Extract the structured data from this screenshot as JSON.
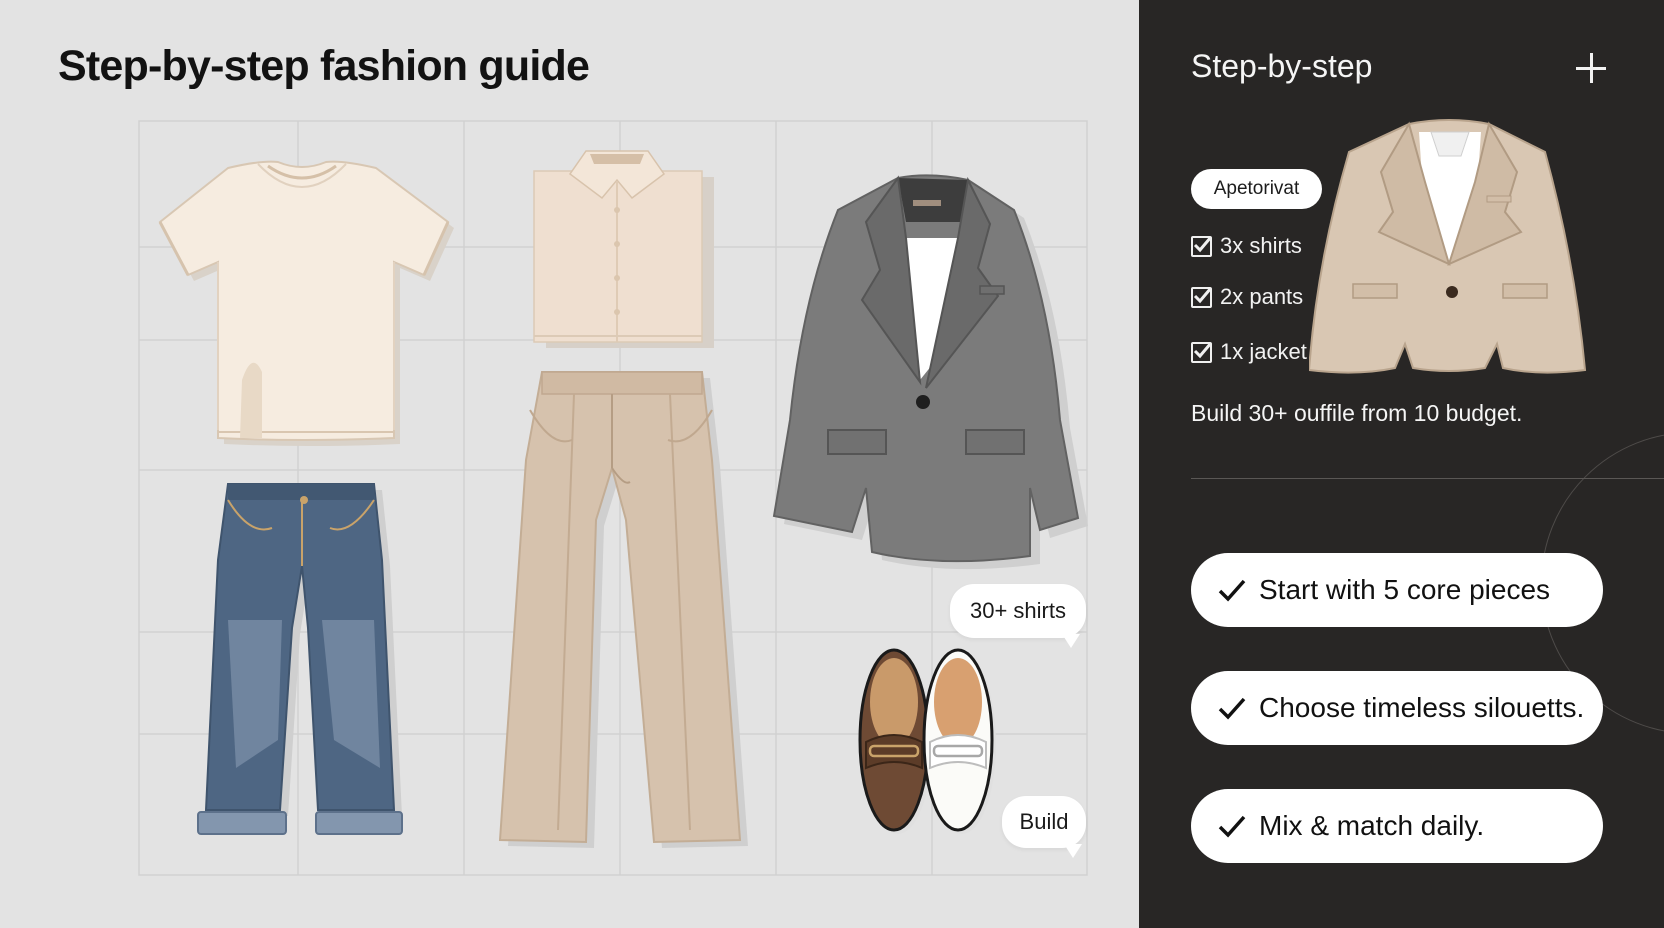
{
  "main": {
    "title": "Step-by-step fashion guide",
    "bubbles": [
      {
        "text": "30+ shirts"
      },
      {
        "text": "Build"
      }
    ]
  },
  "sidebar": {
    "title": "Step-by-step",
    "badge": "Apetorivat",
    "checklist": [
      {
        "label": "3x shirts"
      },
      {
        "label": "2x pants"
      },
      {
        "label": "1x jacket"
      }
    ],
    "summary": "Build 30+ ouffile from 10 budget.",
    "tips": [
      {
        "label": "Start with 5 core pieces"
      },
      {
        "label": "Choose timeless silouetts."
      },
      {
        "label": "Mix & match daily."
      }
    ]
  },
  "colors": {
    "left_bg": "#e3e3e3",
    "right_bg": "#282625",
    "blazer_gray": "#7b7b7b",
    "beige": "#d6c2ad",
    "denim": "#4e6683",
    "tee": "#f6ece0"
  },
  "icons": [
    "plus-icon",
    "checkbox-checked-icon",
    "checkmark-icon"
  ]
}
